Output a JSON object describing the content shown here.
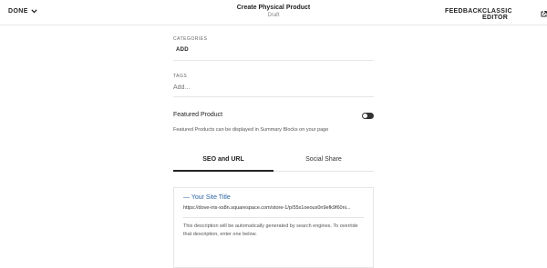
{
  "header": {
    "done_label": "DONE",
    "title": "Create Physical Product",
    "status": "Draft",
    "feedback_label": "FEEDBACK",
    "classic_editor_label": "CLASSIC EDITOR"
  },
  "categories": {
    "label": "CATEGORIES",
    "add_label": "ADD"
  },
  "tags": {
    "label": "TAGS",
    "placeholder": "Add..."
  },
  "featured": {
    "label": "Featured Product",
    "enabled": false,
    "description": "Featured Products can be displayed in Summary Blocks on your page"
  },
  "tabs": [
    {
      "label": "SEO and URL",
      "active": true
    },
    {
      "label": "Social Share",
      "active": false
    }
  ],
  "seo_preview": {
    "title": "— Your Site Title",
    "url": "https://dove-iris-xs8n.squarespace.com/store-1/p/55s1oeoux0n9efk9f60ni...",
    "description": "This description will be automatically generated by search engines. To override that description, enter one below."
  },
  "colors": {
    "link_blue": "#2a64a4",
    "toggle_off": "#333333"
  }
}
